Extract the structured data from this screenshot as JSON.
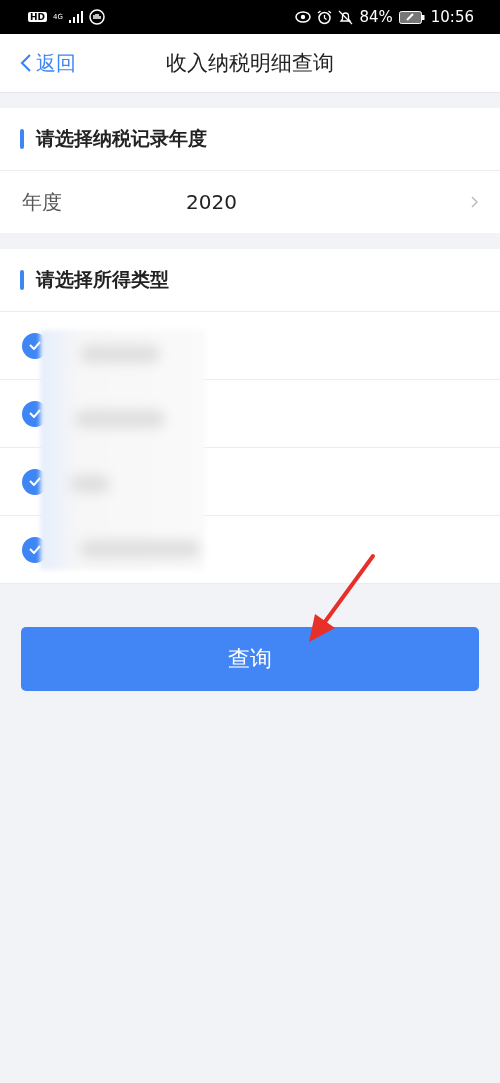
{
  "status_bar": {
    "hd": "HD",
    "network": "4G",
    "battery": "84%",
    "time": "10:56"
  },
  "nav": {
    "back": "返回",
    "title": "收入纳税明细查询"
  },
  "year_section": {
    "heading": "请选择纳税记录年度",
    "label": "年度",
    "value": "2020"
  },
  "type_section": {
    "heading": "请选择所得类型",
    "items": [
      {
        "checked": true
      },
      {
        "checked": true
      },
      {
        "checked": true
      },
      {
        "checked": true
      }
    ]
  },
  "query_button": "查询"
}
